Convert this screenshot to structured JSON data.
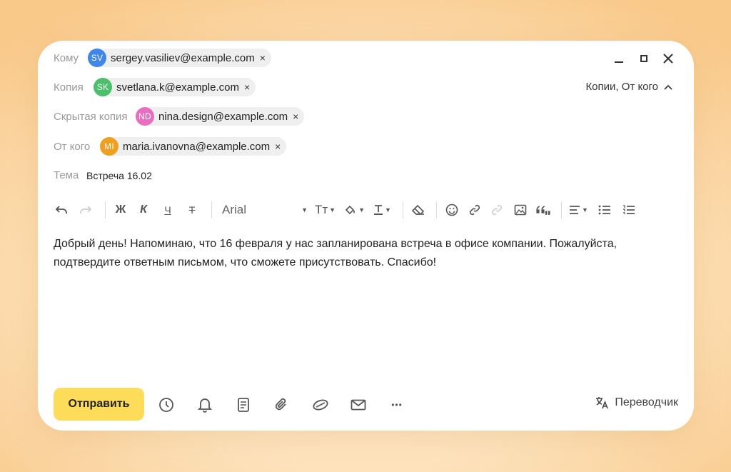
{
  "fields": {
    "to": {
      "label": "Кому",
      "recipients": [
        {
          "initials": "SV",
          "email": "sergey.vasiliev@example.com",
          "color": "#3f86e8"
        }
      ]
    },
    "cc": {
      "label": "Копия",
      "recipients": [
        {
          "initials": "SK",
          "email": "svetlana.k@example.com",
          "color": "#4cbf6b"
        }
      ]
    },
    "bcc": {
      "label": "Скрытая копия",
      "recipients": [
        {
          "initials": "ND",
          "email": "nina.design@example.com",
          "color": "#e86fbf"
        }
      ]
    },
    "from": {
      "label": "От кого",
      "recipients": [
        {
          "initials": "MI",
          "email": "maria.ivanovna@example.com",
          "color": "#f0a020"
        }
      ]
    },
    "subject": {
      "label": "Тема",
      "value": "Встреча 16.02"
    }
  },
  "remove_glyph": "×",
  "header": {
    "copies_toggle": "Копии, От кого"
  },
  "toolbar": {
    "bold": "Ж",
    "italic": "К",
    "underline": "Ч",
    "strike": "Т",
    "font": "Arial",
    "text_size": "Тт"
  },
  "message": {
    "body": "Добрый день! Напоминаю, что 16 февраля у нас запланирована встреча в офисе компании. Пожалуйста, подтвердите ответным письмом, что сможете присутствовать. Спасибо!"
  },
  "footer": {
    "send_label": "Отправить",
    "translator_label": "Переводчик",
    "more_glyph": "•••"
  },
  "colors": {
    "send": "#fddc5a",
    "background": "#fde3bd"
  }
}
